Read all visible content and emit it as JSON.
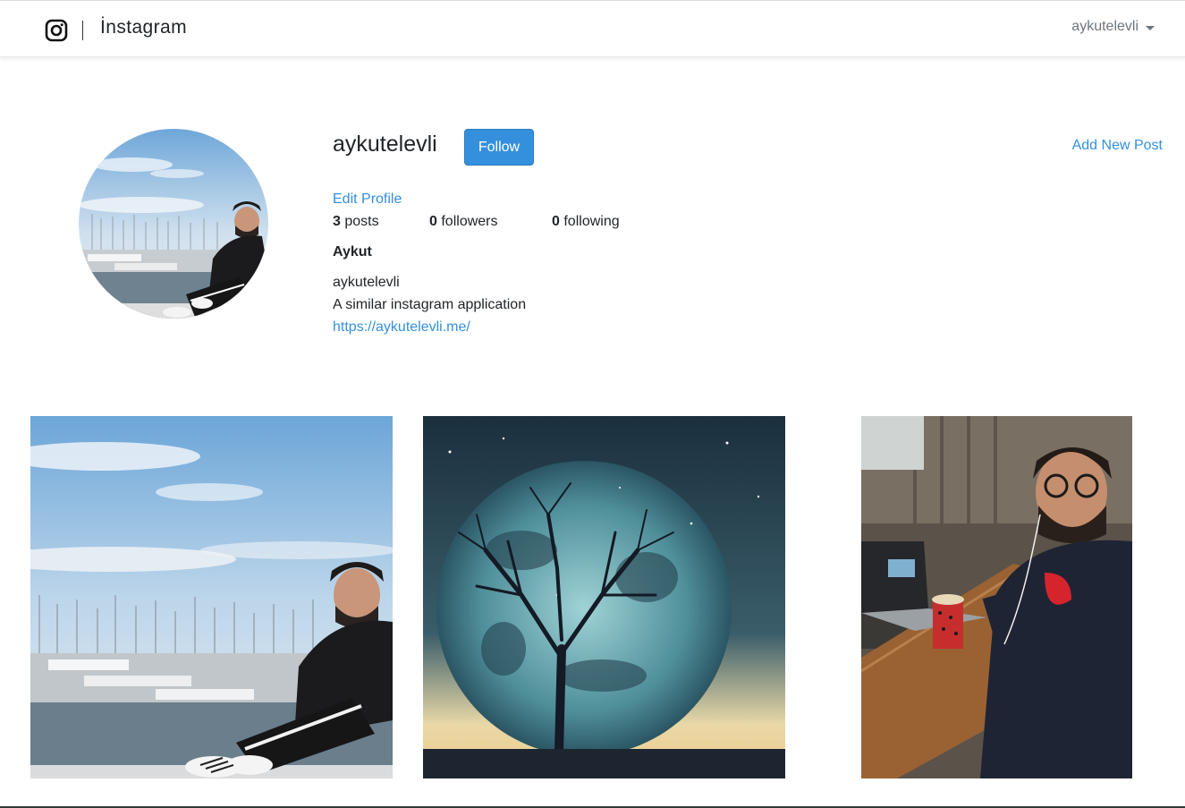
{
  "navbar": {
    "brand_icon": "instagram-camera-icon",
    "brand_name": "İnstagram",
    "user_menu_label": "aykutelevli",
    "user_menu_icon": "caret-down-icon"
  },
  "profile": {
    "username": "aykutelevli",
    "follow_label": "Follow",
    "add_new_post_label": "Add New Post",
    "edit_profile_label": "Edit Profile",
    "stats": {
      "posts_count": "3",
      "posts_label": "posts",
      "followers_count": "0",
      "followers_label": "followers",
      "following_count": "0",
      "following_label": "following"
    },
    "display_name": "Aykut",
    "bio_handle": "aykutelevli",
    "bio_description": "A similar instagram application",
    "bio_url": "https://aykutelevli.me/"
  },
  "colors": {
    "accent": "#3490dc",
    "text": "#212529",
    "muted": "#6c757d"
  }
}
